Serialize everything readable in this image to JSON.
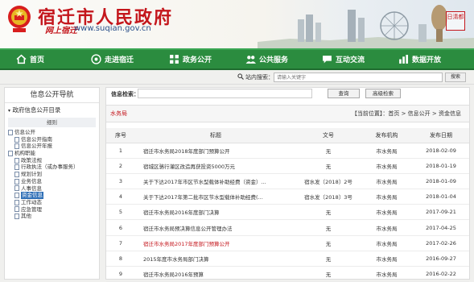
{
  "header": {
    "site_title": "宿迁市人民政府",
    "slogan": "网上宿迁",
    "url": "www.suqian.gov.cn",
    "seal_text": "日清都"
  },
  "nav": {
    "items": [
      {
        "label": "首页",
        "icon": "home-icon"
      },
      {
        "label": "走进宿迁",
        "icon": "map-pin-icon"
      },
      {
        "label": "政务公开",
        "icon": "grid-icon"
      },
      {
        "label": "公共服务",
        "icon": "people-icon"
      },
      {
        "label": "互动交流",
        "icon": "chat-icon"
      },
      {
        "label": "数据开放",
        "icon": "data-icon"
      }
    ]
  },
  "site_search": {
    "label": "站内搜索：",
    "placeholder": "请输入关键字",
    "button": "搜索"
  },
  "sidebar": {
    "title": "信息公开导航",
    "tree_head": "政府信息公开目录",
    "sub_head": "细则",
    "items": [
      {
        "label": "信息公开",
        "level": 0,
        "selected": false
      },
      {
        "label": "信息公开指南",
        "level": 1,
        "selected": false
      },
      {
        "label": "信息公开年报",
        "level": 1,
        "selected": false
      },
      {
        "label": "机构职能",
        "level": 0,
        "selected": false
      },
      {
        "label": "政策法规",
        "level": 1,
        "selected": false
      },
      {
        "label": "行政执法（或办事服务）",
        "level": 1,
        "selected": false
      },
      {
        "label": "规划计划",
        "level": 1,
        "selected": false
      },
      {
        "label": "业务信息",
        "level": 1,
        "selected": false
      },
      {
        "label": "人事信息",
        "level": 1,
        "selected": false
      },
      {
        "label": "资金信息",
        "level": 1,
        "selected": true
      },
      {
        "label": "工作动态",
        "level": 1,
        "selected": false
      },
      {
        "label": "应急管理",
        "level": 1,
        "selected": false
      },
      {
        "label": "其他",
        "level": 1,
        "selected": false
      }
    ]
  },
  "main": {
    "keyword_label": "信息检索：",
    "search_button": "查询",
    "advanced_button": "高级检索",
    "department_tag": "水务局",
    "breadcrumb": "【当前位置】：首页 > 信息公开 > 资金信息",
    "columns": [
      "序号",
      "标题",
      "文号",
      "发布机构",
      "发布日期"
    ],
    "rows": [
      {
        "no": "1",
        "title": "宿迁市水务局2018年度部门预算公开",
        "doc": "无",
        "org": "市水务局",
        "date": "2018-02-09",
        "highlight": false
      },
      {
        "no": "2",
        "title": "宿城区骆行灌区改造再获投资5000万元",
        "doc": "无",
        "org": "市水务局",
        "date": "2018-01-19",
        "highlight": false
      },
      {
        "no": "3",
        "title": "关于下达2017年市区节水型载体补助经费（资金）...",
        "doc": "宿水发〔2018〕2号",
        "org": "市水务局",
        "date": "2018-01-09",
        "highlight": false
      },
      {
        "no": "4",
        "title": "关于下达2017年第二批市区节水型载体补助经费(...",
        "doc": "宿水发〔2018〕3号",
        "org": "市水务局",
        "date": "2018-01-04",
        "highlight": false
      },
      {
        "no": "5",
        "title": "宿迁市水务局2016年度部门决算",
        "doc": "无",
        "org": "市水务局",
        "date": "2017-09-21",
        "highlight": false
      },
      {
        "no": "6",
        "title": "宿迁市水务局预决算信息公开管理办法",
        "doc": "无",
        "org": "市水务局",
        "date": "2017-04-25",
        "highlight": false
      },
      {
        "no": "7",
        "title": "宿迁市水务局2017年度部门预算公开",
        "doc": "无",
        "org": "市水务局",
        "date": "2017-02-26",
        "highlight": true
      },
      {
        "no": "8",
        "title": "2015年度市水务局部门决算",
        "doc": "无",
        "org": "市水务局",
        "date": "2016-09-27",
        "highlight": false
      },
      {
        "no": "9",
        "title": "宿迁市水务局2016年预算",
        "doc": "无",
        "org": "市水务局",
        "date": "2016-02-22",
        "highlight": false
      }
    ]
  },
  "colors": {
    "brand_red": "#c4161c",
    "nav_green": "#2b8c3f",
    "selected_blue": "#2f6fb6"
  }
}
